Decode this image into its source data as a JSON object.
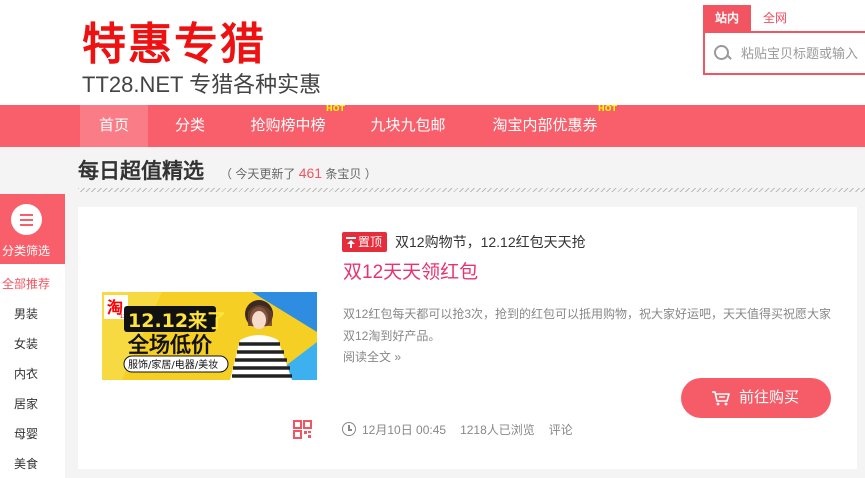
{
  "header": {
    "logo_main": "特惠专猎",
    "logo_sub": "TT28.NET 专猎各种实惠"
  },
  "search": {
    "tabs": [
      "站内",
      "全网"
    ],
    "placeholder": "粘贴宝贝标题或输入"
  },
  "nav": {
    "items": [
      {
        "label": "首页",
        "active": true,
        "hot": false
      },
      {
        "label": "分类",
        "active": false,
        "hot": false
      },
      {
        "label": "抢购榜中榜",
        "active": false,
        "hot": true
      },
      {
        "label": "九块九包邮",
        "active": false,
        "hot": false
      },
      {
        "label": "淘宝内部优惠券",
        "active": false,
        "hot": true
      }
    ],
    "hot_label": "HOT"
  },
  "section": {
    "title": "每日超值精选",
    "note_prefix": "（ 今天更新了",
    "count": "461",
    "note_suffix": "条宝贝 ）"
  },
  "sidebar": {
    "head_label": "分类筛选",
    "items": [
      "全部推荐",
      "男装",
      "女装",
      "内衣",
      "居家",
      "母婴",
      "美食"
    ]
  },
  "item": {
    "pin_label": "置顶",
    "tagline": "双12购物节，12.12红包天天抢",
    "title": "双12天天领红包",
    "description": "双12红包每天都可以抢3次，抢到的红包可以抵用购物，祝大家好运吧，天天值得买祝愿大家双12淘到好产品。",
    "read_more": "阅读全文 »",
    "buy_label": "前往购买",
    "date": "12月10日 00:45",
    "views": "1218人已浏览",
    "comment_label": "评论",
    "banner": {
      "brand": "淘",
      "brand_sub": "1212",
      "line1": "12.12来了",
      "line2": "全场低价",
      "line3": "服饰/家居/电器/美妆"
    }
  },
  "colors": {
    "brand_red": "#ee1111",
    "nav_bg": "#f85f6b",
    "accent_pink": "#e8336f",
    "button": "#f55c68"
  }
}
